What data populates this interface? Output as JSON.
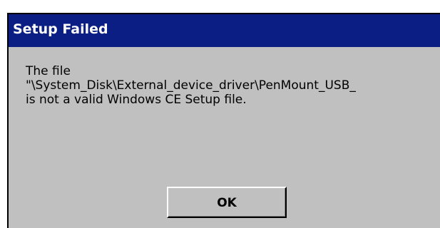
{
  "dialog": {
    "title": "Setup Failed",
    "message_lines": [
      "The file",
      "\"\\System_Disk\\External_device_driver\\PenMount_USB_",
      "is not a valid Windows CE Setup file."
    ],
    "ok_label": "OK"
  },
  "colors": {
    "title_bar": "#0a1e84",
    "title_text": "#ffffff",
    "dialog_background": "#c0c0c0",
    "text": "#000000"
  }
}
